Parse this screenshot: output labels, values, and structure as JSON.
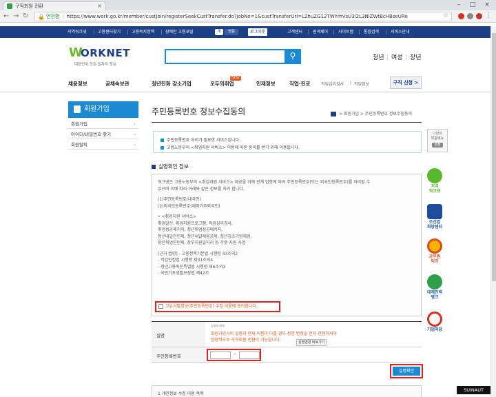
{
  "browser": {
    "tab_title": "구직회원 전환",
    "secure_label": "안전함",
    "url": "https://www.work.go.kr/member/custJoin/registerSeekCustTransfer.do?jobNo=1&custTransferUrl=L2huZG12TWYmVsU3l2L3NlZWtBcHBseURe"
  },
  "util_bar": {
    "links": [
      "지역워크넷",
      "고용센터찾기",
      "고용복지정책",
      "장애인 고용포털"
    ],
    "toggle_label": "영문",
    "login": "로그아웃",
    "right_links": [
      "고객센터",
      "원격제어",
      "사이트맵",
      "통합검색",
      "서비스안내"
    ]
  },
  "header": {
    "logo_mark": "W",
    "logo_text": "ORKNET",
    "tagline": "대한민국 모든 일자리 정보",
    "segments": [
      "청년",
      "여성",
      "장년"
    ]
  },
  "main_nav": {
    "items": [
      "채용정보",
      "공채속보관",
      "청년친화 강소기업",
      "모두의취업",
      "인재정보",
      "직업·진로"
    ],
    "new_badge": "NEW",
    "small_links": [
      "직업심리검사",
      "직업정보"
    ],
    "job_apply": "구직 신청 >"
  },
  "sidebar": {
    "heading": "회원가입",
    "items": [
      {
        "label": "회원가입"
      },
      {
        "label": "아이디/비밀번호 찾기"
      },
      {
        "label": "회원탈퇴"
      }
    ]
  },
  "content": {
    "title": "주민등록번호 정보수집동의",
    "breadcrumb": "> 회원가입 > 주민등록번호 정보수집동의",
    "info": [
      "주민등록번호 처리가 필요한 서비스입니다.",
      "고용노동부의 <취업지원 서비스> 이용에 따른 동의를 받기 위해 이용됩니다."
    ],
    "section_title": "실명확인 정보",
    "terms": [
      "워크넷은 고용노동부의 <취업지원 서비스> 제공을 위해 관계 법령에 따라 주민등록번호(또는 외국인등록번호)를 처리할 수",
      "있으며 이에 따라 아래와 같은 정보를 처리 합니다.",
      "",
      "(1)주민등록번호(내국인)",
      "(2)외국인등록번호(재외거주외국인)",
      "",
      "• <취업지원 서비스>",
      "취업알선, 취업지원프로그램, 직업심리검사,",
      "취업성공패키지, 청년취업성공패키지,",
      "청년내일인턴제, 청년내일채움공제, 청년강소기업체험,",
      "장년취업인턴제, 장부지원일자리 등 각종 지원 사업",
      "",
      "[근거 법령] - 고용정책기본법 시행령 43조의2",
      "- 직업안정법 시행령 제31조의4",
      "- 청년고용촉진특별법 시행령 제6조의3",
      "- 국민기초생활보장법 제42조"
    ],
    "agree_label": "고유식별정보(주민등록번호) 수집 이용에 동의합니다.",
    "form": {
      "name_label": "실명",
      "name_tiny": "김봉보   해제",
      "warn_lines": [
        "회원가입시의 실명과 현재 이름이 다를 경우 성명 변경을 먼저 진행하셔야",
        "정상적으로 구직회원 전환이 가능합니다."
      ],
      "change_btn": "성명변경 바로가기",
      "ssn_label": "주민등록번호",
      "ssn_dash": "-"
    },
    "verify_btn": "실명확인",
    "bottom_section": "1.개인정보 수집 이용 목적"
  },
  "right_banners": {
    "card_lines": [
      "나만의",
      "맞춤메뉴"
    ],
    "card_btn": "설정",
    "items": [
      {
        "label": "지역\n워크넷",
        "color": "#59b82e"
      },
      {
        "label": "조선업\n희망센터",
        "color": "#1e4d9c"
      },
      {
        "label": "공무원\n되기",
        "color": "#e04a1a"
      },
      {
        "label": "대체인력\n뱅크",
        "color": "#1e5eb0"
      },
      {
        "label": "기업마당",
        "color": "#1e4d9c"
      }
    ]
  },
  "watermark": "SUINAUT"
}
